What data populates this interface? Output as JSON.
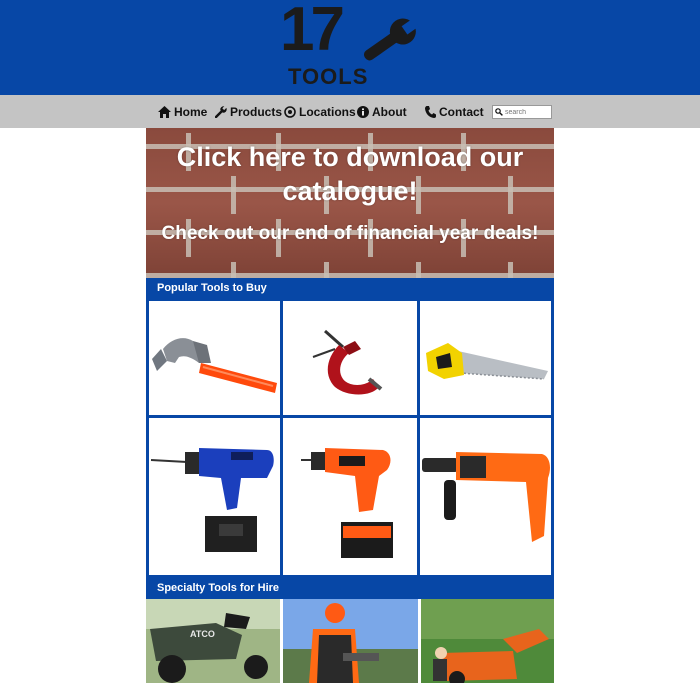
{
  "brand": {
    "logo_number": "17",
    "logo_word": "TOOLS",
    "header_color": "#0747a6",
    "nav_color": "#c4c4c4"
  },
  "nav": {
    "items": [
      {
        "label": "Home",
        "icon": "home-icon"
      },
      {
        "label": "Products",
        "icon": "wrench-icon"
      },
      {
        "label": "Locations",
        "icon": "location-icon"
      },
      {
        "label": "About",
        "icon": "info-icon"
      },
      {
        "label": "Contact",
        "icon": "phone-icon"
      }
    ],
    "search_placeholder": "search"
  },
  "banner": {
    "headline": "Click here to download our catalogue!",
    "subline": "Check out our end of financial year deals!"
  },
  "popular": {
    "title": "Popular Tools to Buy",
    "items": [
      "hammer",
      "g-clamp",
      "hand-saw",
      "blue-cordless-drill",
      "orange-cordless-drill",
      "rotary-hammer-drill"
    ]
  },
  "hire": {
    "title": "Specialty Tools for Hire",
    "items": [
      "ride-on-mower",
      "chainsaw-worker",
      "wood-chipper"
    ]
  }
}
